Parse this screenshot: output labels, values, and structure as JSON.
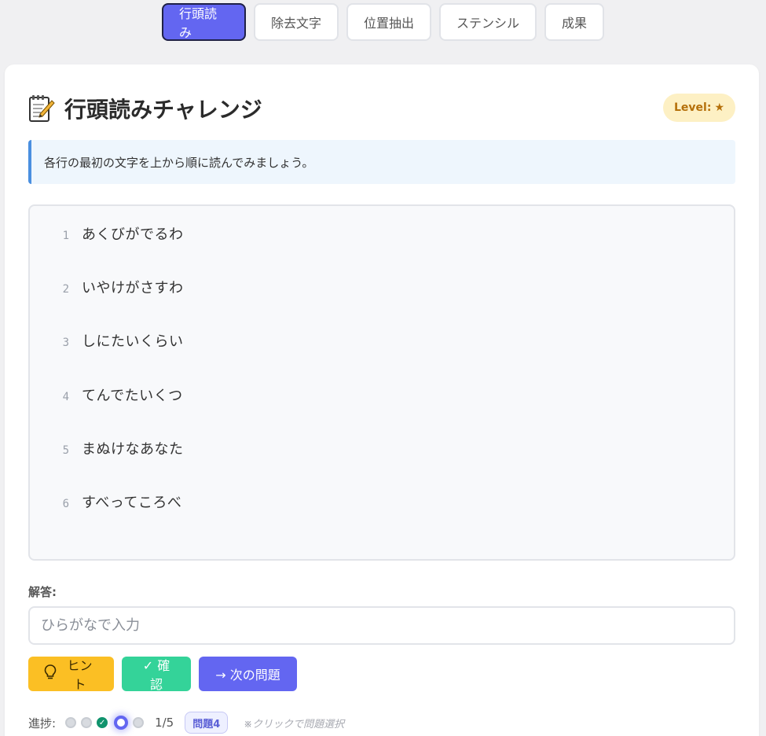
{
  "tabs": [
    {
      "label": "行頭読み",
      "active": true
    },
    {
      "label": "除去文字",
      "active": false
    },
    {
      "label": "位置抽出",
      "active": false
    },
    {
      "label": "ステンシル",
      "active": false
    },
    {
      "label": "成果",
      "active": false
    }
  ],
  "challenge": {
    "title": "行頭読みチャレンジ",
    "level_label": "Level:",
    "level_star": "★",
    "instruction": "各行の最初の文字を上から順に読んでみましょう。"
  },
  "lines": [
    {
      "num": "1",
      "text": "あくびがでるわ"
    },
    {
      "num": "2",
      "text": "いやけがさすわ"
    },
    {
      "num": "3",
      "text": "しにたいくらい"
    },
    {
      "num": "4",
      "text": "てんでたいくつ"
    },
    {
      "num": "5",
      "text": "まぬけなあなた"
    },
    {
      "num": "6",
      "text": "すべってころべ"
    }
  ],
  "answer": {
    "label": "解答:",
    "placeholder": "ひらがなで入力",
    "value": ""
  },
  "buttons": {
    "hint": "ヒント",
    "check": "✓ 確認",
    "next": "→ 次の問題"
  },
  "progress": {
    "label": "進捗:",
    "count": "1/5",
    "question_badge": "問題4",
    "note": "※クリックで問題選択",
    "dots": [
      "pending",
      "pending",
      "done",
      "current",
      "pending"
    ]
  },
  "colors": {
    "accent": "#6366f1",
    "hint": "#fbbf24",
    "check": "#34d399",
    "level_bg": "#fdf0c4",
    "instruction_border": "#4a8fe0"
  }
}
